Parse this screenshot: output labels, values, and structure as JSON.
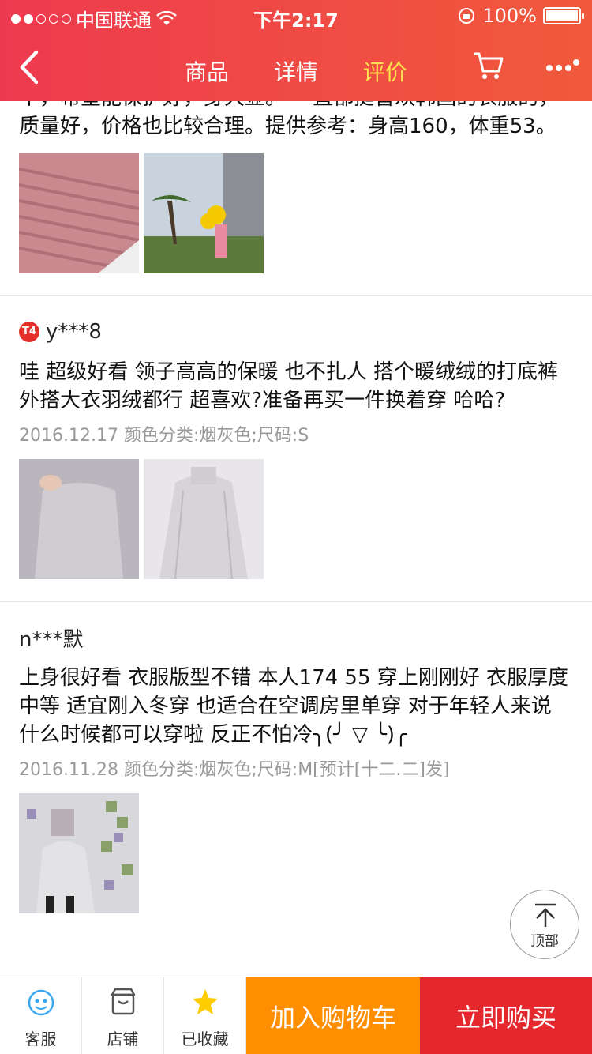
{
  "status_bar": {
    "carrier": "中国联通",
    "time": "下午2:17",
    "battery": "100%"
  },
  "nav": {
    "tabs": [
      {
        "label": "商品"
      },
      {
        "label": "详情"
      },
      {
        "label": "评价"
      }
    ],
    "active_tab": "评价"
  },
  "reviews": [
    {
      "text": "个，希望能保护好，身大显。 一直都挺喜欢韩国的衣服的，质量好，价格也比较合理。提供参考：身高160，体重53。",
      "photos": [
        "pink-knit-sweater",
        "person-with-balloon-outdoors"
      ]
    },
    {
      "user": "y***8",
      "badge": "T4",
      "text": "哇 超级好看  领子高高的保暖 也不扎人   搭个暖绒绒的打底裤  外搭大衣羽绒都行  超喜欢?准备再买一件换着穿  哈哈?",
      "meta": "2016.12.17  颜色分类:烟灰色;尺码:S",
      "photos": [
        "grey-sweater-worn",
        "grey-sweater-closeup"
      ]
    },
    {
      "user": "n***默",
      "text": "上身很好看 衣服版型不错  本人174 55 穿上刚刚好 衣服厚度中等 适宜刚入冬穿 也适合在空调房里单穿 对于年轻人来说 什么时候都可以穿啦 反正不怕冷╮(╯ ▽ ╰)╭",
      "meta": "2016.11.28  颜色分类:烟灰色;尺码:M[预计[十二.二]发]",
      "photos": [
        "mirror-selfie-pixelated"
      ]
    }
  ],
  "to_top": {
    "label": "顶部"
  },
  "bottom_bar": {
    "service": "客服",
    "shop": "店铺",
    "favorite": "已收藏",
    "add_to_cart": "加入购物车",
    "buy_now": "立即购买"
  },
  "colors": {
    "header_start": "#ee3a4f",
    "header_end": "#f05a3a",
    "active_tab": "#ffe14d",
    "add_to_cart": "#ff8e00",
    "buy_now": "#e4282e"
  }
}
